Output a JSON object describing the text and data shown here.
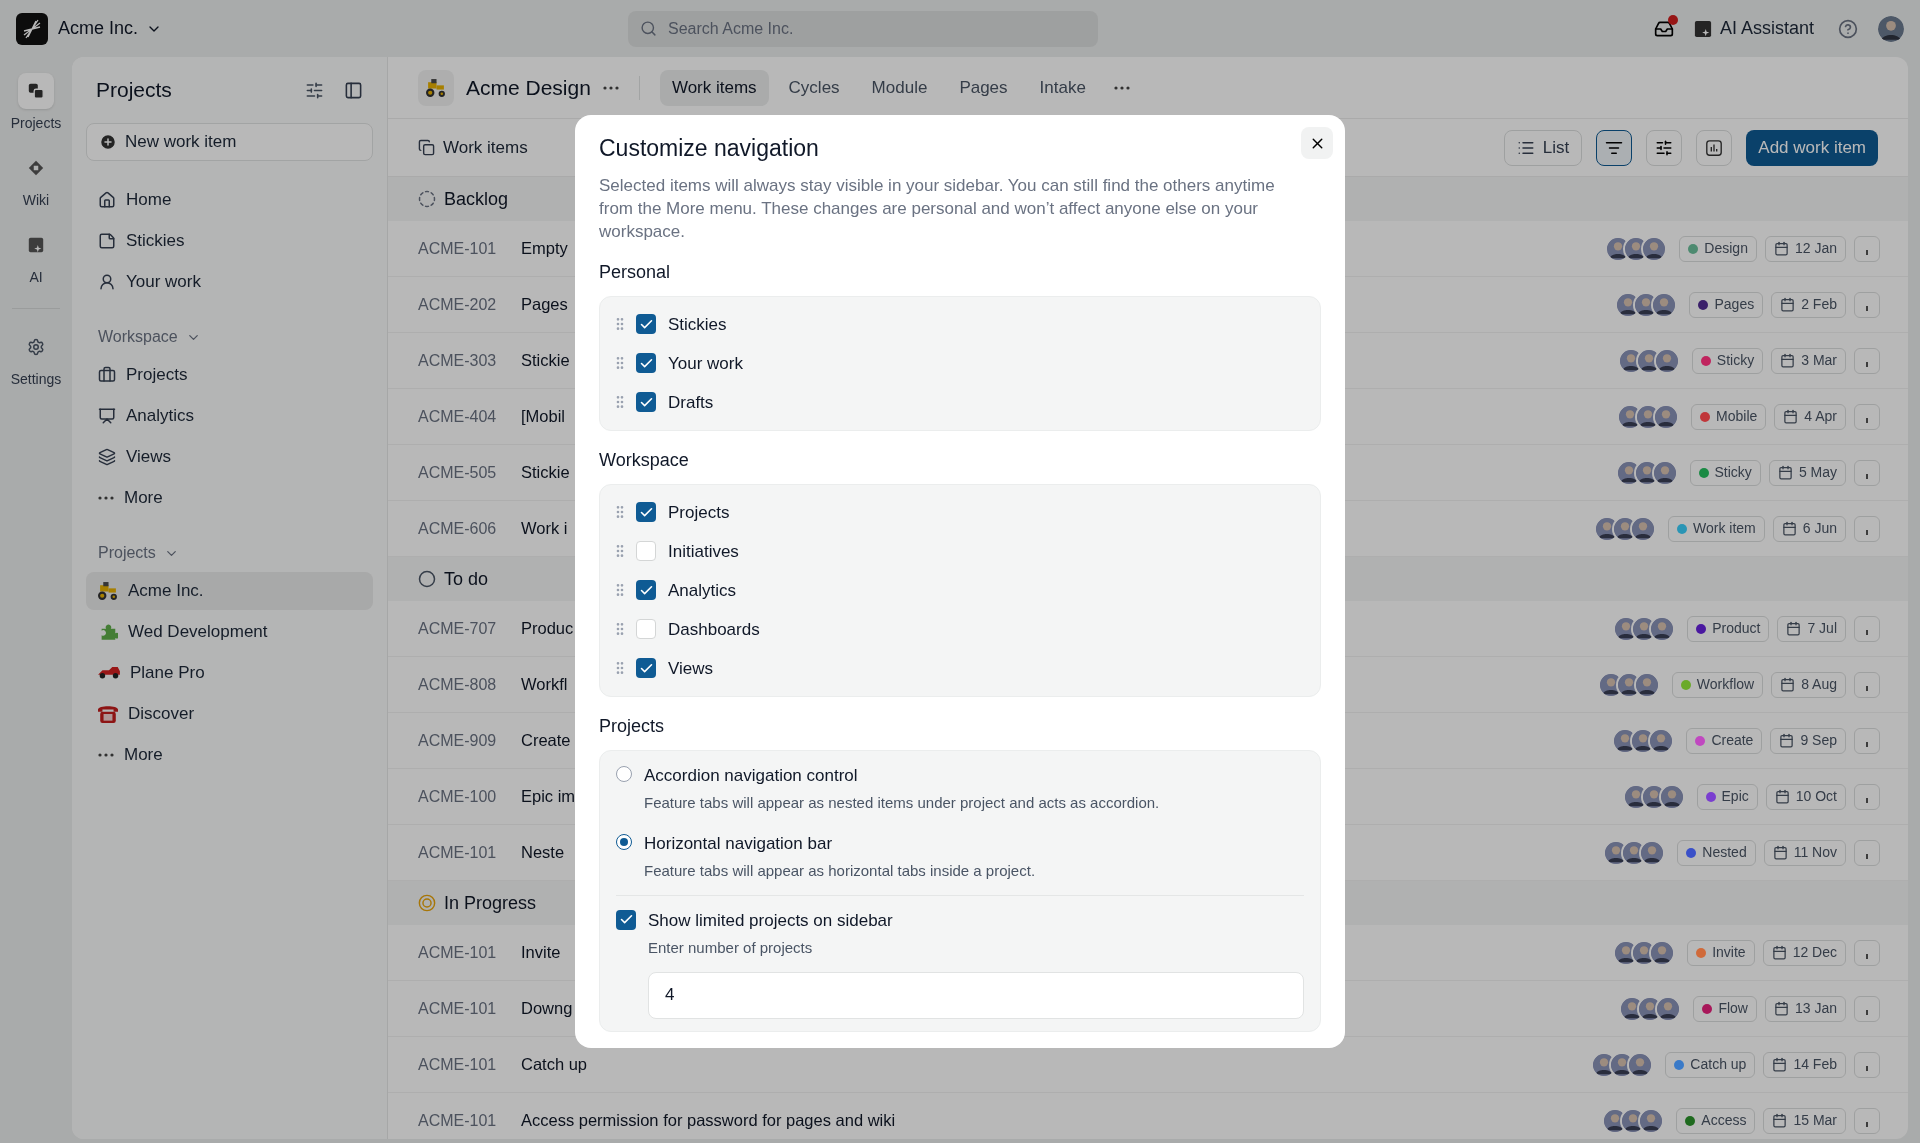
{
  "top_bar": {
    "workspace": "Acme Inc.",
    "search": {
      "placeholder": "Search Acme Inc."
    },
    "inbox": {
      "unread": true
    },
    "assistant": "AI Assistant"
  },
  "rail": {
    "main": [
      {
        "label": "Projects",
        "selected": true
      },
      {
        "label": "Wiki",
        "selected": false
      },
      {
        "label": "AI",
        "selected": false
      }
    ],
    "footer": [
      {
        "label": "Settings",
        "selected": false
      }
    ]
  },
  "sidebar": {
    "title": "Projects",
    "new_item": "New work item",
    "personal": [
      {
        "label": "Home",
        "selected": false
      },
      {
        "label": "Stickies",
        "selected": false
      },
      {
        "label": "Your work",
        "selected": false
      }
    ],
    "sections": [
      {
        "title": "Workspace",
        "expanded": true,
        "items": [
          {
            "label": "Projects",
            "selected": false
          },
          {
            "label": "Analytics",
            "selected": false
          },
          {
            "label": "Views",
            "selected": false
          },
          {
            "label": "More",
            "selected": false
          }
        ]
      },
      {
        "title": "Projects",
        "expanded": true,
        "items": [
          {
            "label": "Acme Inc.",
            "selected": true
          },
          {
            "label": "Wed Development",
            "selected": false
          },
          {
            "label": "Plane Pro",
            "selected": false
          },
          {
            "label": "Discover",
            "selected": false
          },
          {
            "label": "More",
            "selected": false
          }
        ]
      }
    ]
  },
  "project": {
    "name": "Acme Design",
    "tabs": [
      {
        "label": "Work items",
        "selected": true
      },
      {
        "label": "Cycles",
        "selected": false
      },
      {
        "label": "Module",
        "selected": false
      },
      {
        "label": "Pages",
        "selected": false
      },
      {
        "label": "Intake",
        "selected": false
      }
    ]
  },
  "toolbar": {
    "title": "Work items",
    "layout": "List",
    "filter_active": true,
    "add_button": "Add work item"
  },
  "groups": [
    {
      "name": "Backlog",
      "kind": "backlog",
      "rows": [
        {
          "id": "ACME-101",
          "title": "Empty",
          "label": "Design",
          "color": "#4d8a70",
          "due": "12 Jan"
        },
        {
          "id": "ACME-202",
          "title": "Pages",
          "label": "Pages",
          "color": "#3a1f6a",
          "due": "2 Feb"
        },
        {
          "id": "ACME-303",
          "title": "Stickie",
          "label": "Sticky",
          "color": "#c0245e",
          "due": "3 Mar"
        },
        {
          "id": "ACME-404",
          "title": "[Mobil",
          "label": "Mobile",
          "color": "#c0363a",
          "due": "4 Apr"
        },
        {
          "id": "ACME-505",
          "title": "Stickie",
          "label": "Sticky",
          "color": "#1a8a44",
          "due": "5 May"
        },
        {
          "id": "ACME-606",
          "title": "Work i",
          "label": "Work item",
          "color": "#2a95b5",
          "due": "6 Jun"
        }
      ]
    },
    {
      "name": "To do",
      "kind": "todo",
      "rows": [
        {
          "id": "ACME-707",
          "title": "Produc",
          "label": "Product",
          "color": "#4a18a0",
          "due": "7 Jul"
        },
        {
          "id": "ACME-808",
          "title": "Workfl",
          "label": "Workflow",
          "color": "#6aaa2a",
          "due": "8 Aug"
        },
        {
          "id": "ACME-909",
          "title": "Create",
          "label": "Create",
          "color": "#c048c0",
          "due": "9 Sep"
        },
        {
          "id": "ACME-100",
          "title": "Epic im",
          "label": "Epic",
          "color": "#7a3ed0",
          "due": "10 Oct"
        },
        {
          "id": "ACME-101",
          "title": "Neste",
          "label": "Nested",
          "color": "#3a50c8",
          "due": "11 Nov"
        }
      ]
    },
    {
      "name": "In Progress",
      "kind": "in_progress",
      "rows": [
        {
          "id": "ACME-101",
          "title": "Invite",
          "label": "Invite",
          "color": "#d06a3a",
          "due": "12 Dec"
        },
        {
          "id": "ACME-101",
          "title": "Downg",
          "label": "Flow",
          "color": "#a8185a",
          "due": "13 Jan"
        },
        {
          "id": "ACME-101",
          "title": "Catch up",
          "label": "Catch up",
          "color": "#3a7ac8",
          "due": "14 Feb"
        },
        {
          "id": "ACME-101",
          "title": "Access permission for password for pages and wiki",
          "label": "Access",
          "color": "#1f6a1f",
          "due": "15 Mar"
        }
      ]
    }
  ],
  "modal": {
    "title": "Customize navigation",
    "description": "Selected items will always stay visible in your sidebar. You can still find the others anytime from the More menu. These changes are personal and won’t affect anyone else on your workspace.",
    "sections": [
      {
        "title": "Personal",
        "items": [
          {
            "label": "Stickies",
            "checked": true
          },
          {
            "label": "Your work",
            "checked": true
          },
          {
            "label": "Drafts",
            "checked": true
          }
        ]
      },
      {
        "title": "Workspace",
        "items": [
          {
            "label": "Projects",
            "checked": true
          },
          {
            "label": "Initiatives",
            "checked": false
          },
          {
            "label": "Analytics",
            "checked": true
          },
          {
            "label": "Dashboards",
            "checked": false
          },
          {
            "label": "Views",
            "checked": true
          }
        ]
      }
    ],
    "projects": {
      "title": "Projects",
      "options": [
        {
          "label": "Accordion navigation control",
          "description": "Feature tabs will appear as nested items under project and acts as accordion.",
          "selected": false
        },
        {
          "label": "Horizontal navigation bar",
          "description": "Feature tabs will appear as horizontal tabs inside a project.",
          "selected": true
        }
      ],
      "limit": {
        "label": "Show limited projects on sidebar",
        "checked": true,
        "hint": "Enter number of projects",
        "value": "4"
      }
    }
  }
}
